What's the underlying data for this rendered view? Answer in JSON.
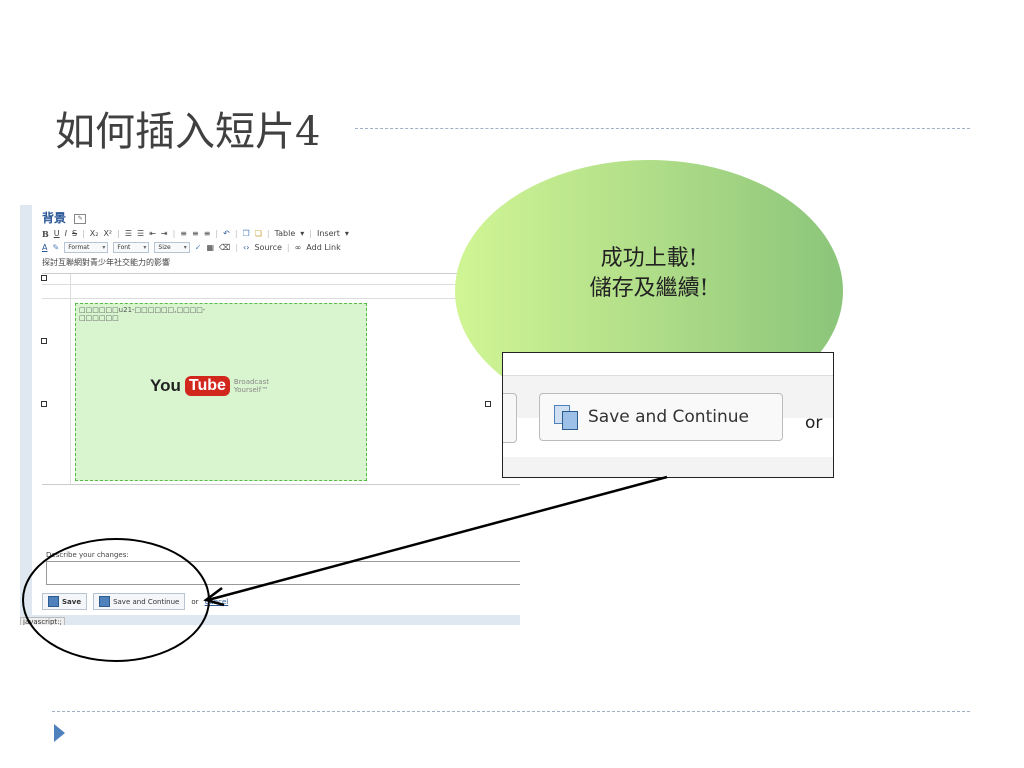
{
  "slide": {
    "title": "如何插入短片4"
  },
  "editor": {
    "heading": "背景",
    "heading_icon": "edit-icon",
    "toolbar_row1": [
      "B",
      "U",
      "I",
      "S",
      "X₂",
      "X²",
      "Table",
      "Insert"
    ],
    "toolbar_row2": {
      "format": "Format",
      "font": "Font",
      "size": "Size",
      "source": "Source",
      "add_link": "Add Link"
    },
    "content_line": "探討互聯網對青少年社交能力的影響",
    "video_caption": "□□□□□□u21-□□□□□□,□□□□-□□□□□□",
    "youtube": {
      "you": "You",
      "tube": "Tube",
      "tagline_1": "Broadcast",
      "tagline_2": "Yourself™"
    },
    "describe_label": "Describe your changes:",
    "save_label": "Save",
    "save_continue_label": "Save and Continue",
    "or_label": "or",
    "cancel_label": "Cancel",
    "status_text": "javascript:;"
  },
  "callout": {
    "line1": "成功上載!",
    "line2": "儲存及繼續!"
  },
  "zoom": {
    "button_label": "Save and Continue",
    "or_label": "or"
  }
}
